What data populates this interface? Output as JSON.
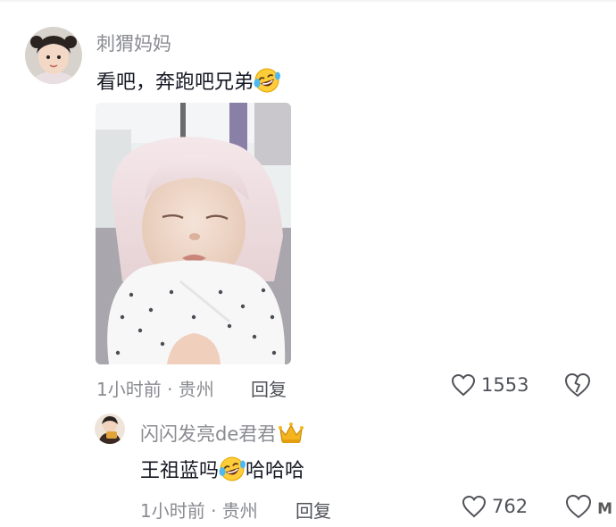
{
  "comments": [
    {
      "username": "刺猬妈妈",
      "text": "看吧，奔跑吧兄弟",
      "emoji": "laughing-tears-emoji",
      "meta": "1小时前 · 贵州",
      "reply_label": "回复",
      "likes": "1553"
    }
  ],
  "reply": {
    "username": "闪闪发亮de君君",
    "badge": "crown-emoji",
    "text_before": "王祖蓝吗",
    "emoji": "laughing-tears-emoji",
    "text_after": "哈哈哈",
    "meta": "1小时前 · 贵州",
    "reply_label": "回复",
    "likes": "762"
  },
  "watermark": "M"
}
